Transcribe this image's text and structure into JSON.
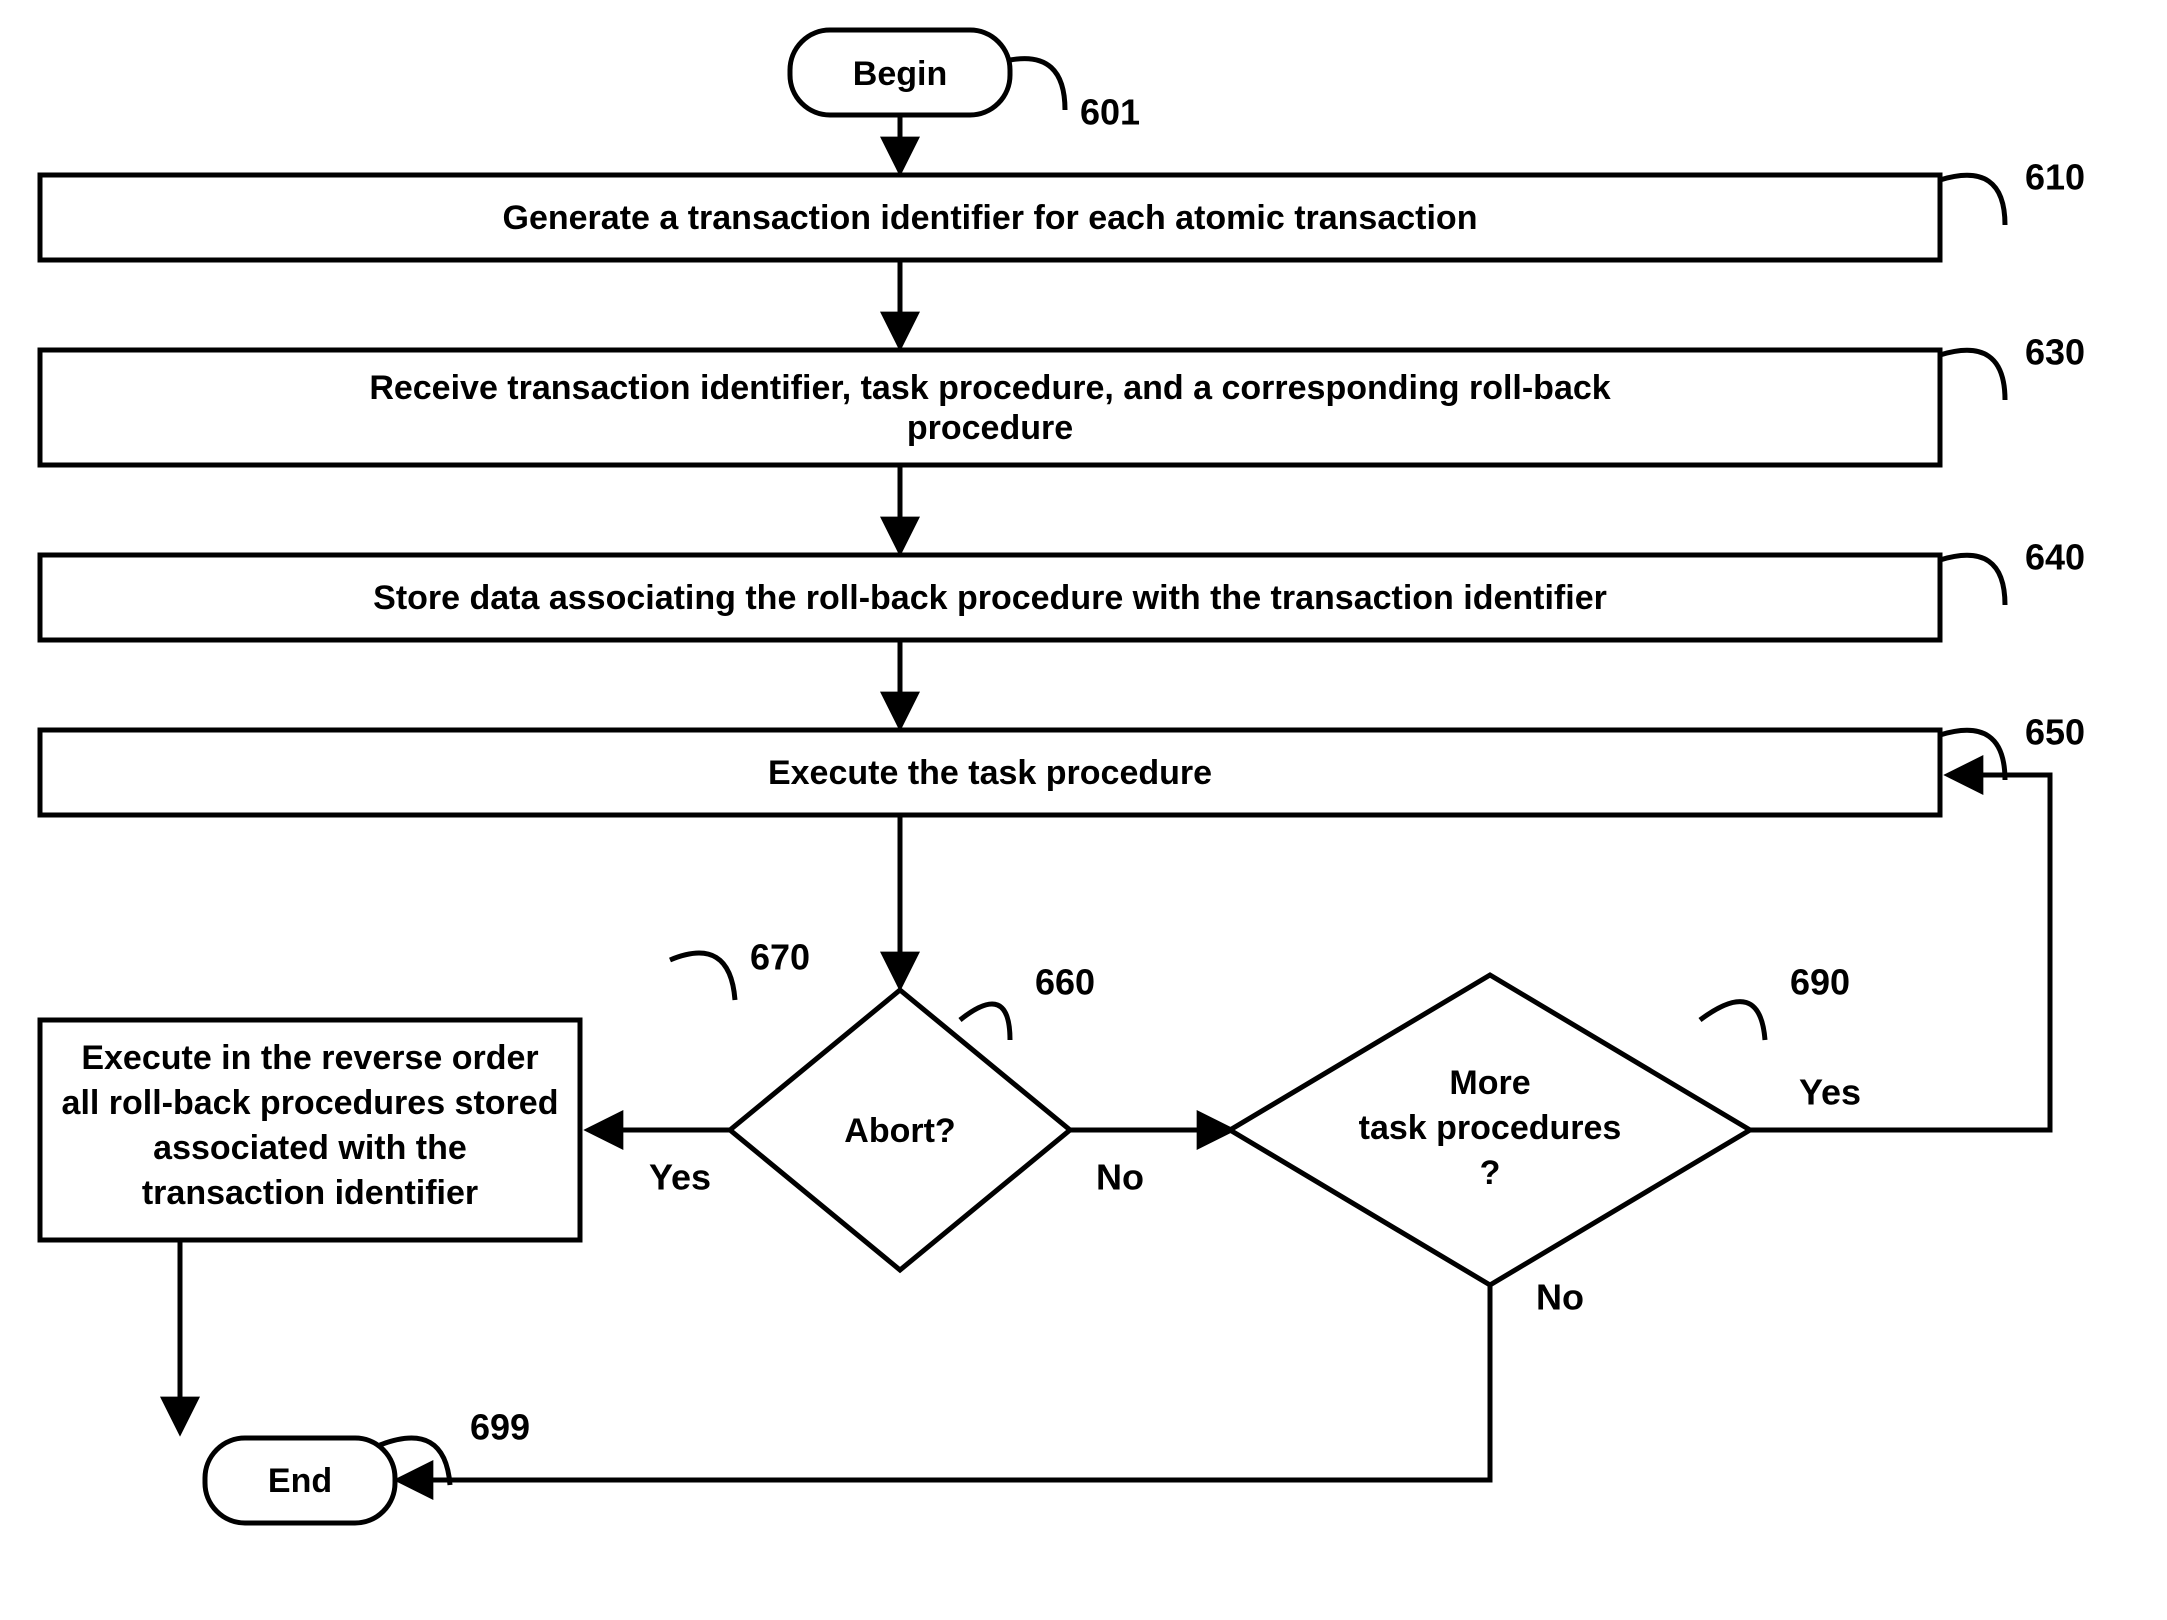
{
  "nodes": {
    "begin": {
      "label": "Begin",
      "ref": "601"
    },
    "n610": {
      "label": "Generate a transaction identifier for each atomic transaction",
      "ref": "610"
    },
    "n630": {
      "label_l1": "Receive transaction identifier, task procedure, and a corresponding roll-back",
      "label_l2": "procedure",
      "ref": "630"
    },
    "n640": {
      "label": "Store data associating the roll-back procedure with the transaction identifier",
      "ref": "640"
    },
    "n650": {
      "label": "Execute the task procedure",
      "ref": "650"
    },
    "n660": {
      "label": "Abort?",
      "ref": "660"
    },
    "n670": {
      "label_l1": "Execute in the reverse order",
      "label_l2": "all roll-back procedures stored",
      "label_l3": "associated with the",
      "label_l4": "transaction identifier",
      "ref": "670"
    },
    "n690": {
      "label_l1": "More",
      "label_l2": "task procedures",
      "label_l3": "?",
      "ref": "690"
    },
    "end": {
      "label": "End",
      "ref": "699"
    }
  },
  "edges": {
    "abort_yes": "Yes",
    "abort_no": "No",
    "more_yes": "Yes",
    "more_no": "No"
  }
}
